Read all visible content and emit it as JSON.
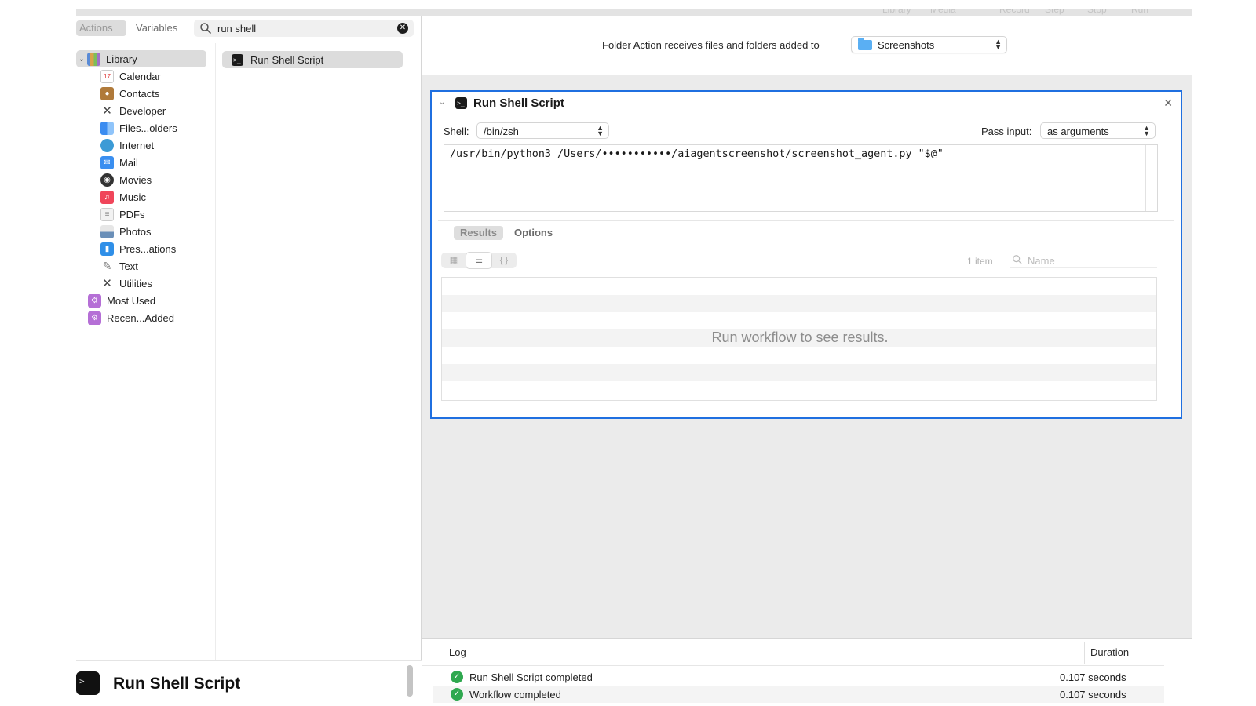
{
  "toolbar": {
    "ghost_labels": [
      "Library",
      "Media",
      "Record",
      "Step",
      "Stop",
      "Run"
    ]
  },
  "library": {
    "tabs": {
      "actions": "Actions",
      "variables": "Variables"
    },
    "search": {
      "value": "run shell"
    },
    "root": "Library",
    "categories": [
      {
        "label": "Calendar",
        "icon": "calendar-icon"
      },
      {
        "label": "Contacts",
        "icon": "contacts-icon"
      },
      {
        "label": "Developer",
        "icon": "developer-icon"
      },
      {
        "label": "Files...olders",
        "icon": "finder-icon"
      },
      {
        "label": "Internet",
        "icon": "globe-icon"
      },
      {
        "label": "Mail",
        "icon": "mail-icon"
      },
      {
        "label": "Movies",
        "icon": "movies-icon"
      },
      {
        "label": "Music",
        "icon": "music-icon"
      },
      {
        "label": "PDFs",
        "icon": "pdf-icon"
      },
      {
        "label": "Photos",
        "icon": "photos-icon"
      },
      {
        "label": "Pres...ations",
        "icon": "keynote-icon"
      },
      {
        "label": "Text",
        "icon": "text-icon"
      },
      {
        "label": "Utilities",
        "icon": "utilities-icon"
      }
    ],
    "smart_groups": [
      {
        "label": "Most Used",
        "icon": "smart-folder-icon"
      },
      {
        "label": "Recen...Added",
        "icon": "smart-folder-icon"
      }
    ],
    "results": [
      {
        "label": "Run Shell Script",
        "icon": "terminal-icon"
      }
    ],
    "description_title": "Run Shell Script"
  },
  "workflow": {
    "folder_action_label": "Folder Action receives files and folders added to",
    "folder_action_target": "Screenshots",
    "action": {
      "title": "Run Shell Script",
      "shell_label": "Shell:",
      "shell_value": "/bin/zsh",
      "pass_input_label": "Pass input:",
      "pass_input_value": "as arguments",
      "script": "/usr/bin/python3 /Users/•••••••••••/aiagentscreenshot/screenshot_agent.py \"$@\"",
      "tabs": {
        "results": "Results",
        "options": "Options"
      },
      "item_count": "1 item",
      "name_placeholder": "Name",
      "empty_message": "Run workflow to see results."
    }
  },
  "log": {
    "headers": {
      "log": "Log",
      "duration": "Duration"
    },
    "entries": [
      {
        "message": "Run Shell Script completed",
        "duration": "0.107 seconds"
      },
      {
        "message": "Workflow completed",
        "duration": "0.107 seconds"
      }
    ]
  },
  "colors": {
    "selection_border": "#1f6fe0",
    "success": "#2fa84f",
    "folder": "#5aaff3"
  }
}
